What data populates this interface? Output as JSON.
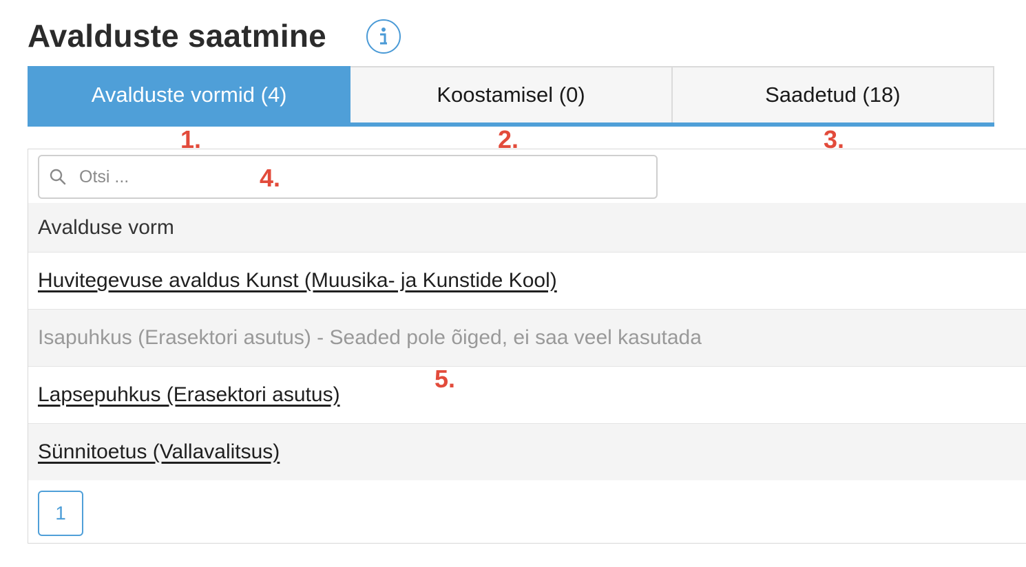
{
  "page": {
    "title": "Avalduste saatmine"
  },
  "tabs": [
    {
      "label": "Avalduste vormid (4)",
      "active": true
    },
    {
      "label": "Koostamisel (0)",
      "active": false
    },
    {
      "label": "Saadetud (18)",
      "active": false
    }
  ],
  "markers": [
    "1.",
    "2.",
    "3.",
    "4.",
    "5."
  ],
  "search": {
    "placeholder": "Otsi ...",
    "value": ""
  },
  "table": {
    "header": "Avalduse vorm",
    "rows": [
      {
        "label": "Huvitegevuse avaldus Kunst (Muusika- ja Kunstide Kool)",
        "link": true
      },
      {
        "label": "Isapuhkus (Erasektori asutus) - Seaded pole õiged, ei saa veel kasutada",
        "link": false
      },
      {
        "label": "Lapsepuhkus (Erasektori asutus)",
        "link": true
      },
      {
        "label": "Sünnitoetus (Vallavalitsus)",
        "link": true
      }
    ]
  },
  "pagination": {
    "current_page": "1"
  },
  "icons": {
    "info": "info-icon",
    "search": "search-icon"
  },
  "colors": {
    "accent": "#4f9fd8",
    "marker": "#e24b3b",
    "disabled_text": "#999999"
  }
}
